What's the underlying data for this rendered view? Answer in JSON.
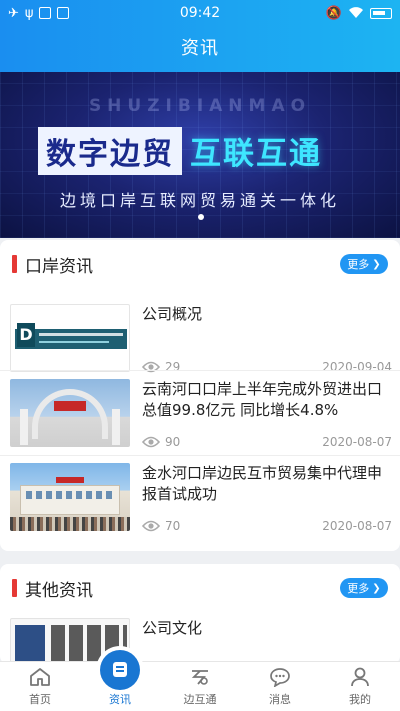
{
  "status_bar": {
    "time": "09:42"
  },
  "header": {
    "title": "资讯"
  },
  "banner": {
    "pinyin": "SHUZIBIANMAO",
    "headline_part1": "数字边贸",
    "headline_part2": "互联互通",
    "subtitle": "边境口岸互联网贸易通关一体化"
  },
  "section_port": {
    "title": "口岸资讯",
    "more_label": "更多",
    "items": [
      {
        "title": "公司概况",
        "views": "29",
        "date": "2020-09-04"
      },
      {
        "title": "云南河口口岸上半年完成外贸进出口总值99.8亿元 同比增长4.8%",
        "views": "90",
        "date": "2020-08-07"
      },
      {
        "title": "金水河口岸边民互市贸易集中代理申报首试成功",
        "views": "70",
        "date": "2020-08-07"
      }
    ]
  },
  "section_other": {
    "title": "其他资讯",
    "more_label": "更多",
    "items": [
      {
        "title": "公司文化"
      }
    ]
  },
  "nav": {
    "items": [
      {
        "label": "首页"
      },
      {
        "label": "资讯"
      },
      {
        "label": "边互通"
      },
      {
        "label": "消息"
      },
      {
        "label": "我的"
      }
    ],
    "active_index": 1,
    "active_color": "#1976d2"
  },
  "colors": {
    "header_start": "#1a8ef0",
    "header_end": "#1db4f2",
    "accent_bar": "#e53935",
    "more_button": "#2196f3"
  }
}
